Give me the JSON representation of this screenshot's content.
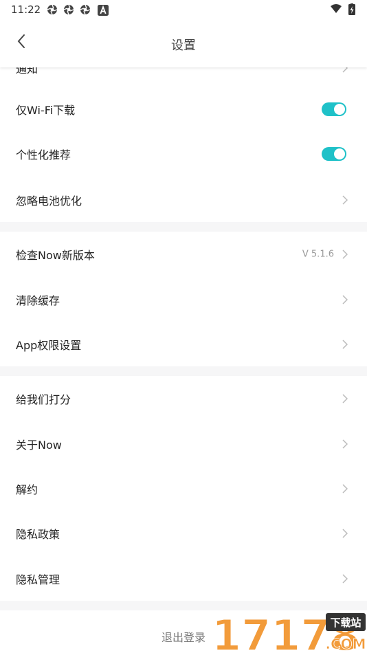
{
  "status_bar": {
    "time": "11:22",
    "notification_icons": [
      "aperture-icon",
      "aperture-icon",
      "aperture-icon",
      "a-badge-icon"
    ],
    "right_icons": [
      "wifi-icon",
      "battery-charging-icon"
    ]
  },
  "header": {
    "title": "设置",
    "back_icon": "chevron-left-icon"
  },
  "settings": {
    "partial_top": {
      "label": "通知"
    },
    "wifi_download": {
      "label": "仅Wi-Fi下载",
      "enabled": true
    },
    "personalized": {
      "label": "个性化推荐",
      "enabled": true
    },
    "battery": {
      "label": "忽略电池优化"
    },
    "check_update": {
      "label": "检查Now新版本",
      "version": "V 5.1.6"
    },
    "clear_cache": {
      "label": "清除缓存"
    },
    "app_permissions": {
      "label": "App权限设置"
    },
    "rate_us": {
      "label": "给我们打分"
    },
    "about": {
      "label": "关于Now"
    },
    "cancel_contract": {
      "label": "解约"
    },
    "privacy_policy": {
      "label": "隐私政策"
    },
    "privacy_manage": {
      "label": "隐私管理"
    }
  },
  "logout": {
    "label": "退出登录"
  },
  "watermark": {
    "text": "17178",
    "badge": "下载站",
    "domain": ".COM"
  },
  "colors": {
    "accent": "#1fc1c8",
    "divider_bg": "#f6f6f7",
    "watermark_orange": "#f29b3a"
  }
}
